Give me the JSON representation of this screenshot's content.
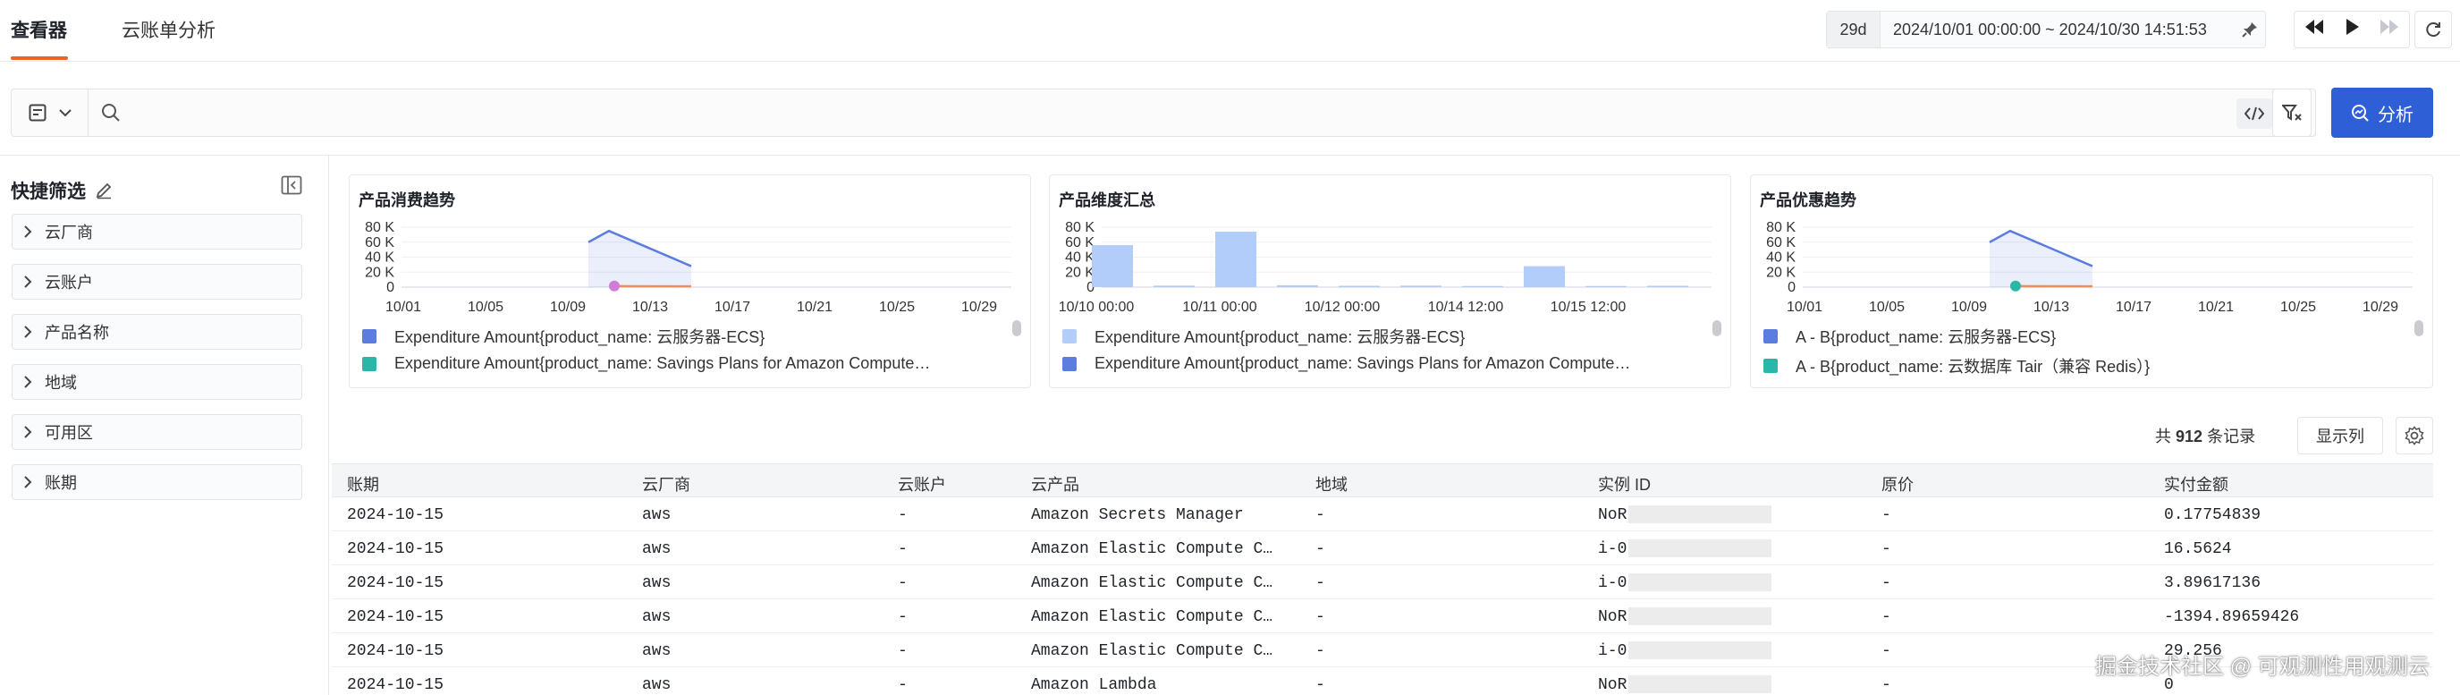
{
  "tabs": [
    {
      "label": "查看器",
      "active": true
    },
    {
      "label": "云账单分析",
      "active": false
    }
  ],
  "time": {
    "duration": "29d",
    "range": "2024/10/01 00:00:00 ~ 2024/10/30 14:51:53"
  },
  "toolbar": {
    "analyze_label": "分析"
  },
  "sidebar": {
    "title": "快捷筛选",
    "items": [
      {
        "label": "云厂商"
      },
      {
        "label": "云账户"
      },
      {
        "label": "产品名称"
      },
      {
        "label": "地域"
      },
      {
        "label": "可用区"
      },
      {
        "label": "账期"
      }
    ]
  },
  "chart_data": [
    {
      "type": "area",
      "title": "产品消费趋势",
      "ylim": [
        0,
        80000
      ],
      "y_ticks": [
        "80 K",
        "60 K",
        "40 K",
        "20 K",
        "0"
      ],
      "x_ticks": [
        "10/01",
        "10/05",
        "10/09",
        "10/13",
        "10/17",
        "10/21",
        "10/25",
        "10/29"
      ],
      "series": [
        {
          "name": "Expenditure Amount{product_name: 云服务器-ECS}",
          "color": "#5b7de0",
          "x": [
            "10/10",
            "10/11",
            "10/15"
          ],
          "values": [
            60000,
            75000,
            28000
          ]
        },
        {
          "name": "Expenditure Amount{product_name: Savings Plans for Amazon Compute…",
          "color": "#f08b5a",
          "x": [
            "10/11",
            "10/12",
            "10/15"
          ],
          "values": [
            1500,
            1200,
            1000
          ]
        }
      ],
      "legend_swatches": [
        "#5b7de0",
        "#2ab7a9"
      ]
    },
    {
      "type": "bar",
      "title": "产品维度汇总",
      "ylim": [
        0,
        80000
      ],
      "y_ticks": [
        "80 K",
        "60 K",
        "40 K",
        "20 K",
        "0"
      ],
      "x_ticks": [
        "10/10 00:00",
        "10/11 00:00",
        "10/12 00:00",
        "10/14 12:00",
        "10/15 12:00"
      ],
      "values": [
        56000,
        2000,
        74000,
        2500,
        1800,
        2000,
        1500,
        28000,
        1500,
        1800
      ],
      "series": [
        {
          "name": "Expenditure Amount{product_name: 云服务器-ECS}",
          "color": "#b3cdfa"
        },
        {
          "name": "Expenditure Amount{product_name: Savings Plans for Amazon Compute…",
          "color": "#5b7de0"
        }
      ]
    },
    {
      "type": "area",
      "title": "产品优惠趋势",
      "ylim": [
        0,
        80000
      ],
      "y_ticks": [
        "80 K",
        "60 K",
        "40 K",
        "20 K",
        "0"
      ],
      "x_ticks": [
        "10/01",
        "10/05",
        "10/09",
        "10/13",
        "10/17",
        "10/21",
        "10/25",
        "10/29"
      ],
      "series": [
        {
          "name": "A - B{product_name: 云服务器-ECS}",
          "color": "#5b7de0",
          "x": [
            "10/10",
            "10/11",
            "10/15"
          ],
          "values": [
            60000,
            75000,
            28000
          ]
        },
        {
          "name": "A - B{product_name: 云数据库 Tair（兼容 Redis）}",
          "color": "#f08b5a",
          "x": [
            "10/11",
            "10/12",
            "10/15"
          ],
          "values": [
            1500,
            1200,
            1000
          ]
        }
      ],
      "legend_swatches": [
        "#5b7de0",
        "#2ab7a9"
      ]
    }
  ],
  "records": {
    "prefix": "共",
    "count": "912",
    "suffix": "条记录"
  },
  "table": {
    "columns_button": "显示列",
    "headers": [
      "账期",
      "云厂商",
      "云账户",
      "云产品",
      "地域",
      "实例 ID",
      "原价",
      "实付金额"
    ],
    "rows": [
      [
        "2024-10-15",
        "aws",
        "-",
        "Amazon Secrets Manager",
        "-",
        "NoR",
        "-",
        "0.17754839"
      ],
      [
        "2024-10-15",
        "aws",
        "-",
        "Amazon Elastic Compute C…",
        "-",
        "i-0                 4b0",
        "-",
        "16.5624"
      ],
      [
        "2024-10-15",
        "aws",
        "-",
        "Amazon Elastic Compute C…",
        "-",
        "i-0                 782",
        "-",
        "3.89617136"
      ],
      [
        "2024-10-15",
        "aws",
        "-",
        "Amazon Elastic Compute C…",
        "-",
        "NoR",
        "-",
        "-1394.89659426"
      ],
      [
        "2024-10-15",
        "aws",
        "-",
        "Amazon Elastic Compute C…",
        "-",
        "i-0                 311",
        "-",
        "29.256"
      ],
      [
        "2024-10-15",
        "aws",
        "-",
        "Amazon Lambda",
        "-",
        "NoR",
        "-",
        "0"
      ]
    ]
  },
  "watermark": "掘金技术社区 @ 可观测性用观测云"
}
